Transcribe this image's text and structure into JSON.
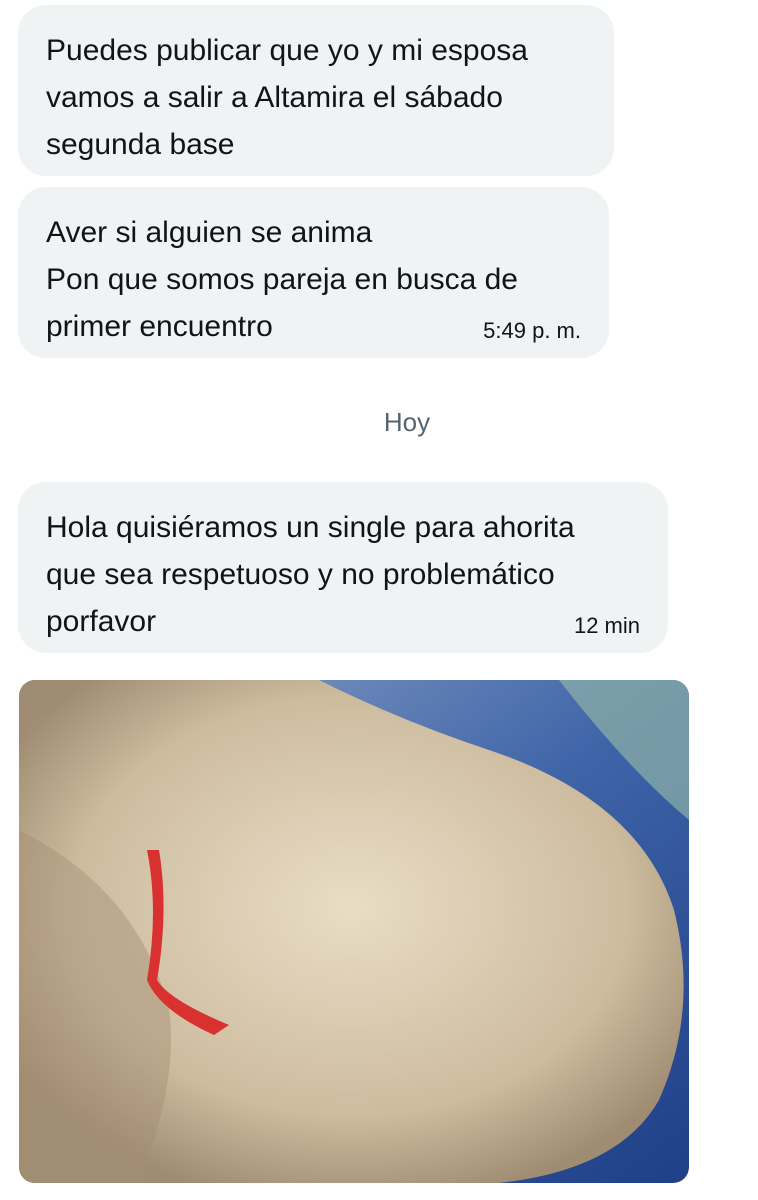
{
  "messages": [
    {
      "text": "Puedes publicar que yo y mi esposa\nvamos a salir a Altamira el sábado\nsegunda base",
      "time": ""
    },
    {
      "text": "Aver si alguien se anima\nPon que  somos pareja en busca de\nprimer encuentro",
      "time": "5:49 p. m."
    },
    {
      "text": "Hola quisiéramos un single para ahorita\nque sea respetuoso y no problemático\nporfavor",
      "time": "12 min"
    }
  ],
  "day_separator": "Hoy",
  "attachment": {
    "type": "photo",
    "icon": "image-attachment"
  },
  "colors": {
    "bubble_bg": "#eff3f4",
    "text": "#0f1419",
    "secondary_text": "#536471",
    "page_bg": "#ffffff"
  }
}
